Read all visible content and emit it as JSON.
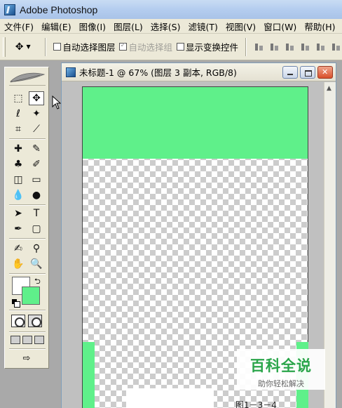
{
  "app": {
    "title": "Adobe Photoshop"
  },
  "menu": {
    "items": [
      "文件(F)",
      "编辑(E)",
      "图像(I)",
      "图层(L)",
      "选择(S)",
      "滤镜(T)",
      "视图(V)",
      "窗口(W)",
      "帮助(H)"
    ]
  },
  "options": {
    "auto_select_layer": "自动选择图层",
    "auto_select_group": "自动选择组",
    "show_transform_controls": "显示变换控件"
  },
  "tools": {
    "marquee": "⬚",
    "move": "✥",
    "lasso": "ℓ",
    "magic_wand": "✦",
    "crop": "⌗",
    "slice": "⟋",
    "healing": "✚",
    "brush": "✎",
    "stamp": "♣",
    "history_brush": "✐",
    "eraser": "◫",
    "gradient": "▭",
    "blur": "💧",
    "dodge": "●",
    "path_select": "➤",
    "type": "T",
    "pen": "✒",
    "shape": "▢",
    "notes": "✍",
    "eyedropper": "⚲",
    "hand": "✋",
    "zoom": "🔍",
    "swap": "⮌",
    "jump": "⇨"
  },
  "document": {
    "title": "未标题-1 @ 67% (图层 3 副本, RGB/8)",
    "figure_label": "图1－3－4"
  },
  "watermark": {
    "title": "百科全说",
    "subtitle": "助你轻松解决"
  },
  "colors": {
    "foreground": "#5ff08a",
    "background": "#ffffff",
    "canvas_fill": "#5ff08a"
  }
}
